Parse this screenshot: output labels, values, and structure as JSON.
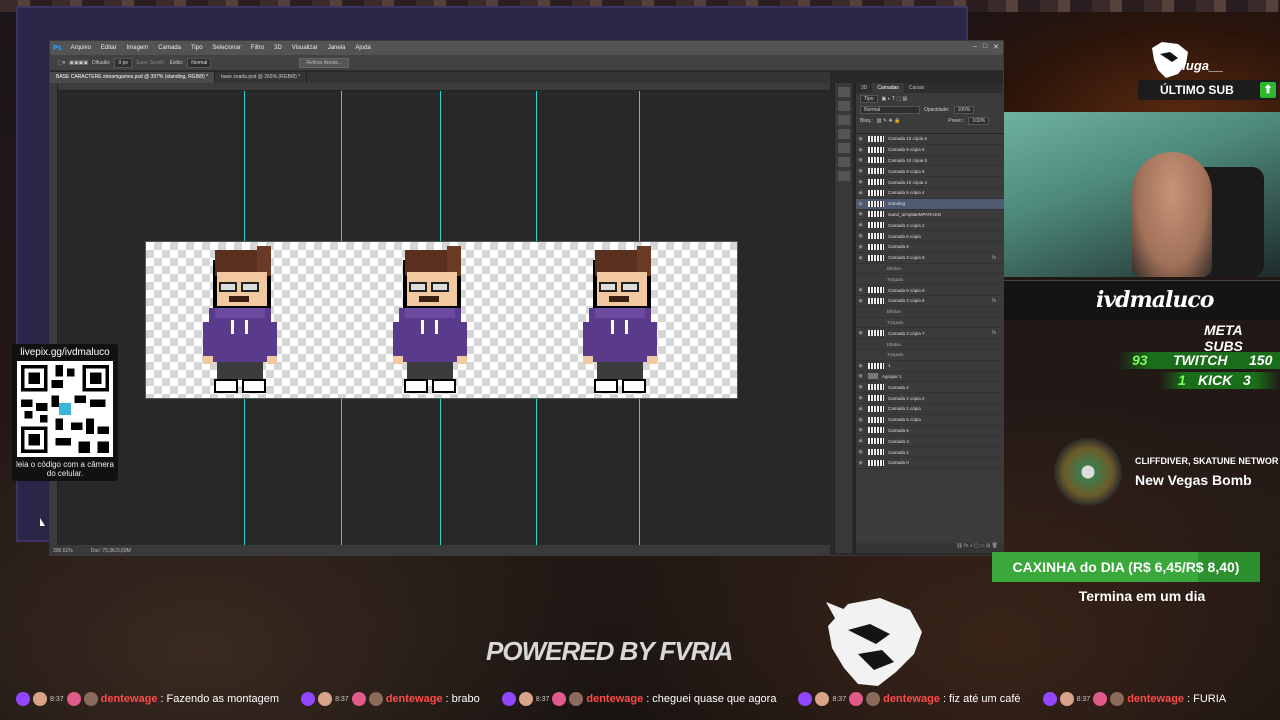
{
  "photoshop": {
    "app_logo": "Ps",
    "menu": [
      "Arquivo",
      "Editar",
      "Imagem",
      "Camada",
      "Tipo",
      "Selecionar",
      "Filtro",
      "3D",
      "Visualizar",
      "Janela",
      "Ajuda"
    ],
    "options": {
      "difusao_label": "Difusão:",
      "difusao_value": "0 px",
      "suav_label": "Suav. Serrilh.",
      "estilo_label": "Estilo:",
      "estilo_value": "Normal",
      "refine_button": "Refinar Aresta..."
    },
    "tabs": [
      "BASE CARACTERE streamgames.psd @ 397% (standing, RGB/8) *",
      "base zoada.psd @ 265% (RGB/8) *"
    ],
    "status": {
      "zoom": "396,61%",
      "doc": "Doc: 70,3K/3,69M"
    },
    "panel_tabs": [
      "3D",
      "Camadas",
      "Canais"
    ],
    "panel_controls": {
      "kind": "Tipo",
      "blend": "Normal",
      "opacity_label": "Opacidade:",
      "opacity": "100%",
      "lock_label": "Bloq.:",
      "fill_label": "Preen.:",
      "fill": "100%"
    },
    "layers": [
      {
        "name": "Camada 10 cópia 6",
        "type": "layer"
      },
      {
        "name": "Camada 9 cópia 6",
        "type": "layer"
      },
      {
        "name": "Camada 10 cópia 5",
        "type": "layer"
      },
      {
        "name": "Camada 9 cópia 5",
        "type": "layer"
      },
      {
        "name": "Camada 10 cópia 4",
        "type": "layer"
      },
      {
        "name": "Camada 9 cópia 4",
        "type": "layer"
      },
      {
        "name": "standing",
        "type": "selected"
      },
      {
        "name": "stand_templateMPARADO",
        "type": "layer"
      },
      {
        "name": "Camada 4 cópia 2",
        "type": "layer"
      },
      {
        "name": "Camada 6 cópia",
        "type": "layer"
      },
      {
        "name": "Camada 6",
        "type": "layer"
      },
      {
        "name": "Camada 3 cópia 9",
        "type": "fx"
      },
      {
        "name": "Efeitos",
        "type": "sub"
      },
      {
        "name": "Traçado",
        "type": "sub"
      },
      {
        "name": "Camada 6 cópia 6",
        "type": "layer"
      },
      {
        "name": "Camada 3 cópia 8",
        "type": "fx"
      },
      {
        "name": "Efeitos",
        "type": "sub"
      },
      {
        "name": "Traçado",
        "type": "sub"
      },
      {
        "name": "Camada 3 cópia 7",
        "type": "fx"
      },
      {
        "name": "Efeitos",
        "type": "sub"
      },
      {
        "name": "Traçado",
        "type": "sub"
      },
      {
        "name": "1",
        "type": "layer"
      },
      {
        "name": "Agrupar 1",
        "type": "group"
      },
      {
        "name": "Camada 4",
        "type": "layer"
      },
      {
        "name": "Camada 2 cópia 2",
        "type": "layer"
      },
      {
        "name": "Camada 2 cópia",
        "type": "layer"
      },
      {
        "name": "Camada 5 cópia",
        "type": "layer"
      },
      {
        "name": "Camada 5",
        "type": "layer"
      },
      {
        "name": "Camada 3",
        "type": "layer"
      },
      {
        "name": "Camada 2",
        "type": "layer"
      },
      {
        "name": "Camada 0",
        "type": "layer"
      }
    ]
  },
  "qr": {
    "title": "livepix.gg/ivdmaluco",
    "caption": "leia o código com a câmera do celular."
  },
  "sub_alert": {
    "name": "raluga__",
    "label": "ÚLTIMO SUB",
    "arrow": "⬆"
  },
  "streamer": {
    "name": "ivdmaluco"
  },
  "meta": {
    "label": "META SUBS",
    "twitch_current": "93",
    "twitch_label": "TWITCH",
    "twitch_goal": "150",
    "kick_current": "1",
    "kick_label": "KICK",
    "kick_goal": "3"
  },
  "now_playing": {
    "artist": "CLIFFDIVER, SKATUNE NETWOR",
    "song": "New Vegas Bomb"
  },
  "goal": {
    "text": "CAXINHA do DIA (R$ 6,45/R$ 8,40)",
    "progress": 0.77,
    "ends": "Termina em um dia"
  },
  "branding": {
    "powered": "POWERED BY FVRIA"
  },
  "chat": [
    {
      "time": "8:37",
      "user": "dentewage",
      "msg": "Fazendo as montagem"
    },
    {
      "time": "8:37",
      "user": "dentewage",
      "msg": "brabo"
    },
    {
      "time": "8:37",
      "user": "dentewage",
      "msg": "cheguei quase que agora"
    },
    {
      "time": "8:37",
      "user": "dentewage",
      "msg": "fiz até um café"
    },
    {
      "time": "8:37",
      "user": "dentewage",
      "msg": "FURIA"
    }
  ],
  "colors": {
    "accent_green": "#2e8f2e",
    "guide": "#29d4d4",
    "chat_user": "#ff4a4a",
    "ps_blue": "#31a8ff"
  }
}
